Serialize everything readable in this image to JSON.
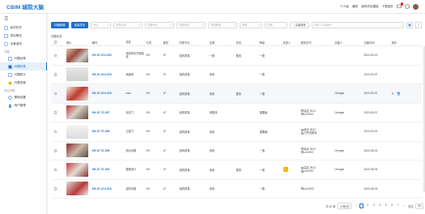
{
  "app": {
    "logo_text": "CBIM 城院大脑",
    "top_links": [
      "个人版",
      "通知",
      "我的项目模板",
      "下载插件"
    ],
    "notification_count": "1"
  },
  "sidebar": {
    "items": [
      {
        "label": "我的任务",
        "icon": "clipboard-icon"
      },
      {
        "label": "项目概览",
        "icon": "dashboard-icon"
      },
      {
        "label": "全景漫游",
        "icon": "globe-icon"
      }
    ],
    "group1": "问题",
    "sub_items": [
      {
        "label": "问题台账",
        "icon": "list-icon",
        "active": false
      },
      {
        "label": "问题列表",
        "icon": "table-icon",
        "active": true
      },
      {
        "label": "问题统计",
        "icon": "chart-icon",
        "active": false
      },
      {
        "label": "问题流程",
        "icon": "flow-icon",
        "active": false
      }
    ],
    "group2": "项目设置",
    "bottom_items": [
      {
        "label": "基础设置",
        "icon": "gear-icon"
      },
      {
        "label": "用户管理",
        "icon": "user-icon"
      }
    ]
  },
  "toolbar": {
    "new_issue_label": "问题新增",
    "batch_label": "批量导出",
    "filters": [
      {
        "placeholder": "专业",
        "has_arrow": true
      },
      {
        "placeholder": "问题分类",
        "has_arrow": true
      },
      {
        "placeholder": "问题专业",
        "has_arrow": true
      },
      {
        "placeholder": "问题状态",
        "has_arrow": true
      },
      {
        "placeholder": "问题等级",
        "has_arrow": true
      },
      {
        "placeholder": "审核",
        "has_arrow": true
      },
      {
        "placeholder": "日期",
        "has_arrow": false
      }
    ],
    "search_button": "高级搜索",
    "search_placeholder": "请输入问题编号"
  },
  "filter_tag": "问题状态:",
  "table": {
    "headers": [
      "照片",
      "编号",
      "描述",
      "分类",
      "楼层",
      "所属专业",
      "位置",
      "状态",
      "等级",
      "检查人",
      "整改情况",
      "创建人",
      "创建时间",
      "操作"
    ],
    "rows": [
      {
        "code": "SH-1F-JG1-020",
        "name": "墙体抹灰开裂裂缝",
        "cat": "SH",
        "floor": "1F",
        "major": "结构质量",
        "pos": "一般",
        "status": "整改",
        "level": "一般",
        "checker": "",
        "fix": [],
        "creator": "",
        "date": "2023-09-13",
        "thumb": "t1",
        "hl": false,
        "warn": false
      },
      {
        "code": "SH-1F-JG1-019",
        "name": "墙面抹",
        "cat": "SH",
        "floor": "1F",
        "major": "结构质量",
        "pos": "待改",
        "status": "",
        "level": "一般",
        "checker": "",
        "fix": [],
        "creator": "",
        "date": "2023-09-07",
        "thumb": "t2",
        "hl": false,
        "warn": false
      },
      {
        "code": "SH-1F-JG1-018",
        "name": "weiz",
        "cat": "SH",
        "floor": "1F",
        "major": "结构质量",
        "pos": "待改",
        "status": "整改",
        "level": "一般",
        "checker": "",
        "fix": [],
        "creator": "Gengan",
        "date": "2023-09-07",
        "thumb": "t3",
        "hl": true,
        "warn": false
      },
      {
        "code": "SH-1F-TZ-007",
        "name": "测试门",
        "cat": "SH",
        "floor": "1F",
        "major": "结构质量",
        "pos": "待整改",
        "status": "",
        "level": "重要级",
        "checker": "",
        "fix": [
          "监控 0912",
          "cst 0907"
        ],
        "creator": "Gengan",
        "date": "2023-09-07",
        "thumb": "t4",
        "hl": false,
        "warn": false
      },
      {
        "code": "SH-1F-TZ-006",
        "name": "立面门",
        "cat": "SH",
        "floor": "1F",
        "major": "结构质量",
        "pos": "待改",
        "status": "",
        "level": "重要级",
        "checker": "",
        "fix": [
          "最近 0912",
          "已完成整改"
        ],
        "creator": "",
        "date": "2023-09-01",
        "thumb": "t5",
        "hl": false,
        "warn": false
      },
      {
        "code": "SH-1F-TZ-005",
        "name": "综合问题",
        "cat": "SH",
        "floor": "1F",
        "major": "结构质量",
        "pos": "待改",
        "status": "",
        "level": "一般",
        "checker": "",
        "fix": [
          "最近 0912",
          "cst 0907"
        ],
        "creator": "Gengan",
        "date": "2023-08-23",
        "thumb": "t6",
        "hl": false,
        "warn": false
      },
      {
        "code": "SH-1F-TZ-003",
        "name": "楼梯设计",
        "cat": "SH",
        "floor": "1F",
        "major": "结构质量",
        "pos": "待改",
        "status": "整改",
        "level": "一般",
        "checker": "",
        "fix": [
          "监控 0912",
          "cst 0907"
        ],
        "creator": "Gengan",
        "date": "2023-08-03",
        "thumb": "t7",
        "hl": false,
        "warn": true
      },
      {
        "code": "SH-1F-JG1-016",
        "name": "结构问题",
        "cat": "SH",
        "floor": "1F",
        "major": "结构质量",
        "pos": "待改",
        "status": "",
        "level": "一般",
        "checker": "",
        "fix": [
          "cst 0922"
        ],
        "creator": "",
        "date": "2023-08-03",
        "thumb": "t8",
        "hl": false,
        "warn": false
      }
    ]
  },
  "pager": {
    "total": "共 69 条",
    "size": "10条/页",
    "pages": [
      "1",
      "2",
      "3",
      "4",
      "5",
      "6",
      "7"
    ],
    "current": "1",
    "jump_label": "前往",
    "jump_value": "50"
  }
}
